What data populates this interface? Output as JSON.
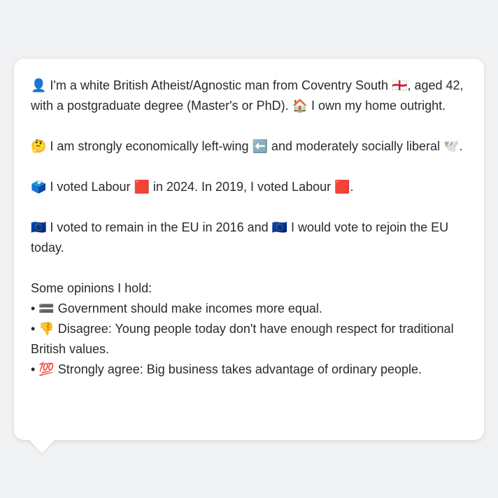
{
  "message": {
    "line1_a": "👤 I'm a white British Atheist/Agnostic man from Coventry South 🏴󠁧󠁢󠁥󠁮󠁧󠁿, aged 42, with a postgraduate degree (Master's or PhD). 🏠 I own my home outright.",
    "line2": "🤔 I am strongly economically left-wing ⬅️ and moderately socially liberal 🕊️.",
    "line3": "🗳️ I voted Labour 🟥 in 2024. In 2019, I voted Labour 🟥.",
    "line4": "🇪🇺 I voted to remain in the EU in 2016 and 🇪🇺 I would vote to rejoin the EU today.",
    "opinions_heading": "Some opinions I hold:",
    "opinions": [
      "• 🟰 Government should make incomes more equal.",
      "• 👎 Disagree: Young people today don't have enough respect for traditional British values.",
      "• 💯 Strongly agree: Big business takes advantage of ordinary people."
    ]
  }
}
